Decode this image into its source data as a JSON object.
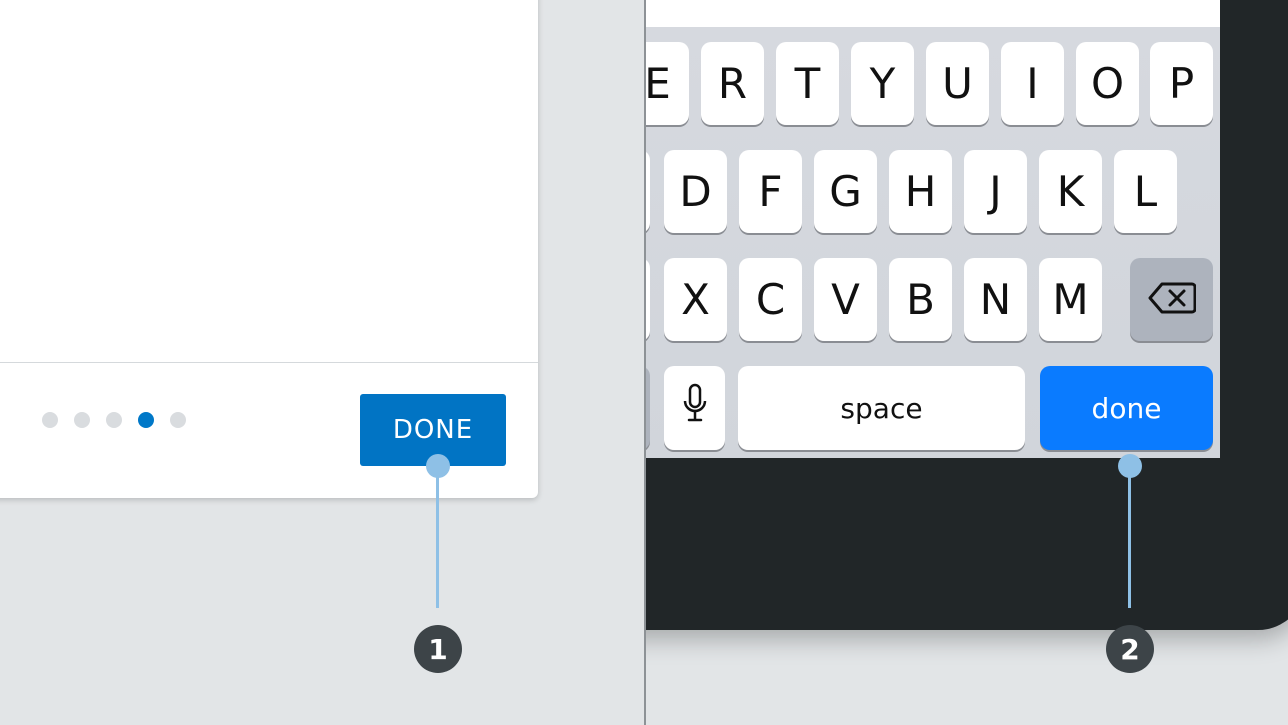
{
  "left_panel": {
    "pagination": {
      "total": 5,
      "active_index": 3
    },
    "done_button_label": "DONE",
    "callout_label": "1"
  },
  "right_panel": {
    "keyboard": {
      "row1": [
        "E",
        "R",
        "T",
        "Y",
        "U",
        "I",
        "O",
        "P"
      ],
      "row2": [
        "D",
        "F",
        "G",
        "H",
        "J",
        "K",
        "L"
      ],
      "row3": [
        "X",
        "C",
        "V",
        "B",
        "N",
        "M"
      ],
      "space_label": "space",
      "done_label": "done",
      "icons": [
        "backspace-icon",
        "microphone-icon"
      ]
    },
    "callout_label": "2"
  },
  "colors": {
    "done_button": "#0174c4",
    "keyboard_done": "#0a7bff",
    "callout": "#8ec0e6",
    "badge": "#3d4448",
    "active_dot": "#0078c8"
  }
}
